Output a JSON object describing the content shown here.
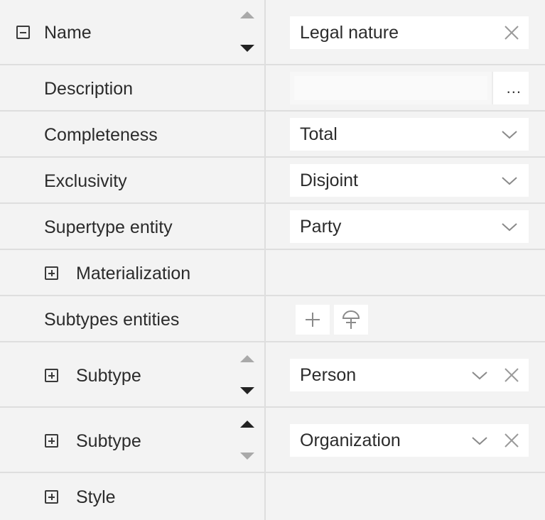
{
  "rows": {
    "name": {
      "label": "Name",
      "value": "Legal nature"
    },
    "description": {
      "label": "Description",
      "value": "",
      "ellipsis": "..."
    },
    "completeness": {
      "label": "Completeness",
      "value": "Total"
    },
    "exclusivity": {
      "label": "Exclusivity",
      "value": "Disjoint"
    },
    "supertype": {
      "label": "Supertype entity",
      "value": "Party"
    },
    "materialization": {
      "label": "Materialization"
    },
    "subtypes": {
      "label": "Subtypes entities"
    },
    "subtype1": {
      "label": "Subtype",
      "value": "Person"
    },
    "subtype2": {
      "label": "Subtype",
      "value": "Organization"
    },
    "style": {
      "label": "Style"
    }
  },
  "icons": {
    "collapse": "minus-box-icon",
    "expand": "plus-box-icon",
    "clear": "close-icon",
    "dropdown": "chevron-down-icon",
    "move_up": "arrow-up-icon",
    "move_down": "arrow-down-icon",
    "add": "plus-icon",
    "add_subtype": "subtype-symbol-icon"
  },
  "colors": {
    "panel_bg": "#f3f3f3",
    "field_bg": "#ffffff",
    "divider": "#dedede",
    "text": "#2b2b2b",
    "arrow_active": "#222222",
    "arrow_inactive": "#a9a9a9"
  }
}
